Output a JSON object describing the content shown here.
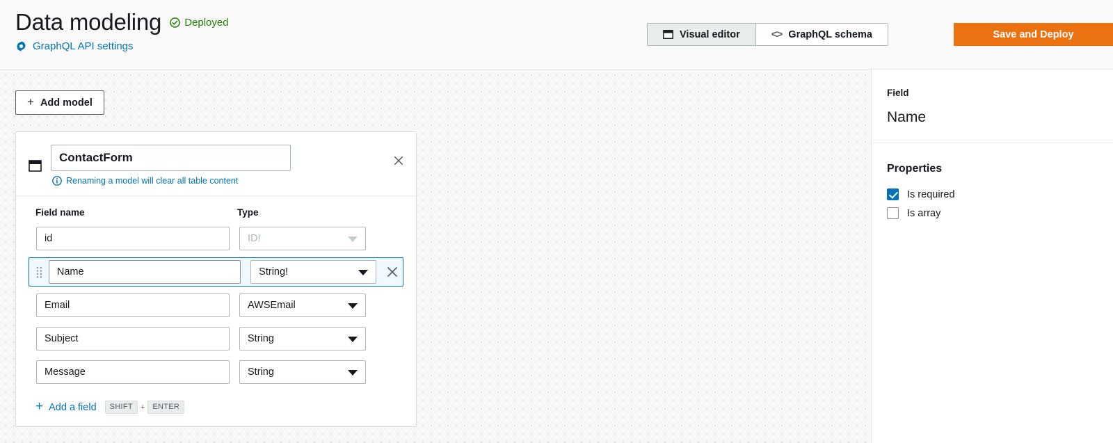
{
  "header": {
    "title": "Data modeling",
    "status_badge": {
      "label": "Deployed",
      "icon": "check-circle-icon",
      "color": "#1d8102"
    },
    "settings_link": {
      "label": "GraphQL API settings",
      "icon": "gear-icon",
      "color": "#0073bb"
    },
    "editor_tabs": [
      {
        "label": "Visual editor",
        "icon": "window-icon",
        "selected": true
      },
      {
        "label": "GraphQL schema",
        "icon": "code-brackets-icon",
        "selected": false
      }
    ],
    "save_button": {
      "label": "Save and Deploy",
      "color": "#ec7211"
    }
  },
  "canvas": {
    "add_model_button": {
      "label": "Add model",
      "icon": "plus-icon"
    },
    "model": {
      "icon": "table-icon",
      "name": "ContactForm",
      "name_placeholder": "Model name",
      "rename_note": {
        "icon": "info-icon",
        "text": "Renaming a model will clear all table content"
      },
      "close_icon": "close-icon",
      "columns": {
        "field_name": "Field name",
        "type": "Type"
      },
      "fields": [
        {
          "name": "id",
          "type": "ID!",
          "disabled": true,
          "selected": false,
          "placeholder": "Field name"
        },
        {
          "name": "Name",
          "type": "String!",
          "disabled": false,
          "selected": true,
          "placeholder": "Field name"
        },
        {
          "name": "Email",
          "type": "AWSEmail",
          "disabled": false,
          "selected": false,
          "placeholder": "Field name"
        },
        {
          "name": "Subject",
          "type": "String",
          "disabled": false,
          "selected": false,
          "placeholder": "Field name"
        },
        {
          "name": "Message",
          "type": "String",
          "disabled": false,
          "selected": false,
          "placeholder": "Field name"
        }
      ],
      "add_field": {
        "label": "Add a field",
        "icon": "plus-icon",
        "shortcut_keys": [
          "SHIFT",
          "ENTER"
        ],
        "shortcut_sep": "+"
      }
    }
  },
  "side_panel": {
    "field_label": "Field",
    "field_value": "Name",
    "properties_title": "Properties",
    "properties": [
      {
        "label": "Is required",
        "checked": true
      },
      {
        "label": "Is array",
        "checked": false
      }
    ]
  }
}
